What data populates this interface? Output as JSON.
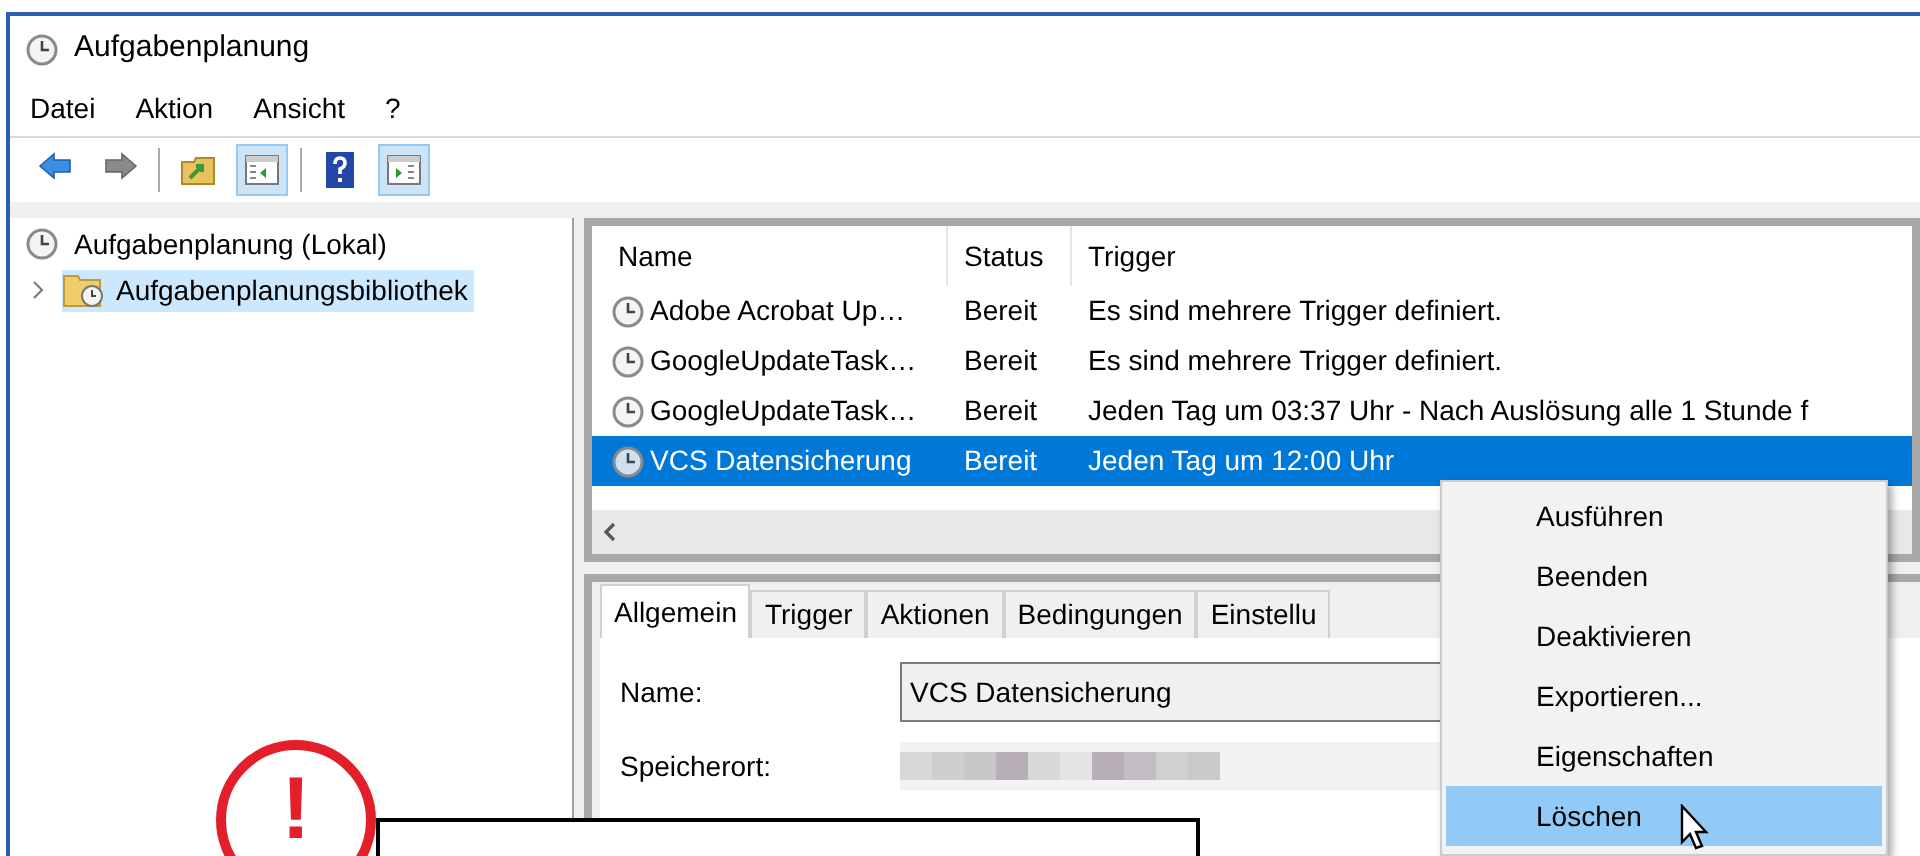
{
  "window": {
    "title": "Aufgabenplanung"
  },
  "menu": [
    "Datei",
    "Aktion",
    "Ansicht",
    "?"
  ],
  "toolbar": [
    {
      "kind": "back"
    },
    {
      "kind": "forward"
    },
    {
      "kind": "separator"
    },
    {
      "kind": "folder-up"
    },
    {
      "kind": "pane-left",
      "selected": true
    },
    {
      "kind": "separator"
    },
    {
      "kind": "help"
    },
    {
      "kind": "pane-right",
      "selected": true
    }
  ],
  "tree": [
    {
      "label": "Aufgabenplanung (Lokal)",
      "selected": false,
      "children": [
        {
          "label": "Aufgabenplanungsbibliothek",
          "selected": true,
          "expanded": false
        }
      ]
    }
  ],
  "table": {
    "columns": [
      "Name",
      "Status",
      "Trigger"
    ],
    "rows": [
      {
        "name": "Adobe Acrobat Up…",
        "status": "Bereit",
        "trigger": "Es sind mehrere Trigger definiert.",
        "selected": false
      },
      {
        "name": "GoogleUpdateTask…",
        "status": "Bereit",
        "trigger": "Es sind mehrere Trigger definiert.",
        "selected": false
      },
      {
        "name": "GoogleUpdateTask…",
        "status": "Bereit",
        "trigger": "Jeden Tag um 03:37 Uhr - Nach Auslösung alle 1 Stunde f",
        "selected": false
      },
      {
        "name": "VCS Datensicherung",
        "status": "Bereit",
        "trigger": "Jeden Tag um 12:00 Uhr",
        "selected": true
      }
    ]
  },
  "details": {
    "tabs": [
      {
        "label": "Allgemein",
        "selected": true
      },
      {
        "label": "Trigger",
        "selected": false
      },
      {
        "label": "Aktionen",
        "selected": false
      },
      {
        "label": "Bedingungen",
        "selected": false
      },
      {
        "label": "Einstellu",
        "selected": false
      }
    ],
    "fields": [
      {
        "label": "Name:",
        "value": "VCS Datensicherung",
        "kind": "input"
      },
      {
        "label": "Speicherort:",
        "kind": "redacted"
      }
    ]
  },
  "context_menu": [
    {
      "label": "Ausführen",
      "selected": false
    },
    {
      "label": "Beenden",
      "selected": false
    },
    {
      "label": "Deaktivieren",
      "selected": false
    },
    {
      "label": "Exportieren...",
      "selected": false
    },
    {
      "label": "Eigenschaften",
      "selected": false
    },
    {
      "label": "Löschen",
      "selected": true
    }
  ],
  "callout": {
    "mark": "!"
  }
}
